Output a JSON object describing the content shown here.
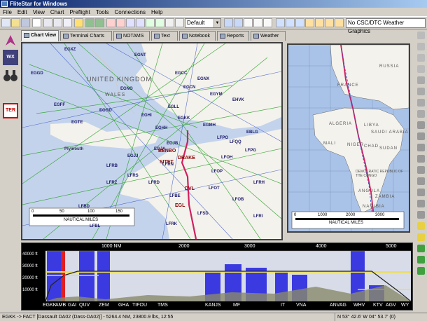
{
  "window": {
    "title": "FliteStar for Windows"
  },
  "menu": [
    "File",
    "Edit",
    "View",
    "Chart",
    "Preflight",
    "Tools",
    "Connections",
    "Help"
  ],
  "toolbar": {
    "chart_select": "Default",
    "weather_select": "No CSC/DTC Weather Graphics"
  },
  "tabs": [
    "Chart View",
    "Terminal Charts",
    "NOTAMS",
    "Text",
    "Notebook",
    "Reports",
    "Weather"
  ],
  "left_tools": [
    {
      "name": "route-tool",
      "icon": "arrow-icon"
    },
    {
      "name": "weather-tool",
      "label": "WX"
    },
    {
      "name": "binoculars-tool",
      "icon": "binoculars-icon"
    },
    {
      "name": "ter-tool",
      "label": "TER"
    }
  ],
  "map_left": {
    "country_labels": [
      "UNITED KINGDOM",
      "WALES"
    ],
    "airports": [
      "EGXZ",
      "EGNT",
      "EGGD",
      "EGCC",
      "EGNX",
      "EGCN",
      "EGNO",
      "EGYM",
      "EGFF",
      "EGGD",
      "EGTE",
      "EGHI",
      "EGHH",
      "EGKK",
      "EGLL",
      "EGMH",
      "EBLG",
      "EHVK",
      "LFRB",
      "LFRN",
      "LFRD",
      "LFOP",
      "LFPG",
      "LFQQ",
      "LFRS",
      "LFRZ",
      "LFBD",
      "LFBE",
      "LFOB",
      "LFSD",
      "LFBL",
      "EGJA",
      "EGJJ",
      "LFRK",
      "LFRH",
      "LFRI",
      "LFPO",
      "LFOH",
      "LFOT",
      "EGJB"
    ],
    "place_labels": [
      "Plymouth",
      "BENBO",
      "DRAKE",
      "SITET",
      "DVL",
      "EGL"
    ],
    "scale": {
      "ticks": [
        "0",
        "50",
        "100",
        "150"
      ],
      "unit": "NAUTICAL MILES"
    }
  },
  "map_right": {
    "country_labels": [
      "RUSSIA",
      "FRANCE",
      "ALGERIA",
      "LIBYA",
      "SAUDI ARABIA",
      "MALI",
      "NIGER",
      "CHAD",
      "SUDAN",
      "DEMOCRATIC REPUBLIC OF THE CONGO",
      "ANGOLA",
      "ZAMBIA",
      "NAMIBIA"
    ],
    "scale": {
      "ticks": [
        "0",
        "1000",
        "2000",
        "3000"
      ],
      "unit": "NAUTICAL MILES"
    }
  },
  "profile": {
    "distance_ticks": [
      "1000 NM",
      "2000",
      "3000",
      "4000",
      "5000"
    ],
    "altitude_ticks": [
      "40000 ft",
      "30000 ft",
      "20000 ft",
      "10000 ft"
    ],
    "waypoints": [
      "EGKK",
      "AMB",
      "GAI",
      "QUV",
      "ZEM",
      "GHA",
      "TIFOU",
      "TMS",
      "KANJS",
      "MF",
      "IT",
      "VNA",
      "ANVAG",
      "WHV",
      "KTV",
      "AGV",
      "WY"
    ]
  },
  "status": {
    "route": "EGKK -> FACT [Dassault DA02 (Dass-DA02)] - 5264.4 NM, 23800.9 lbs, 12:55",
    "coords": "N 53° 42.6' W 04° 53.7' (0)"
  },
  "colors": {
    "title_start": "#0a246a",
    "title_end": "#a6caf0",
    "route": "#d02060",
    "airway_green": "#2aa02a",
    "airway_blue": "#3050c8"
  }
}
